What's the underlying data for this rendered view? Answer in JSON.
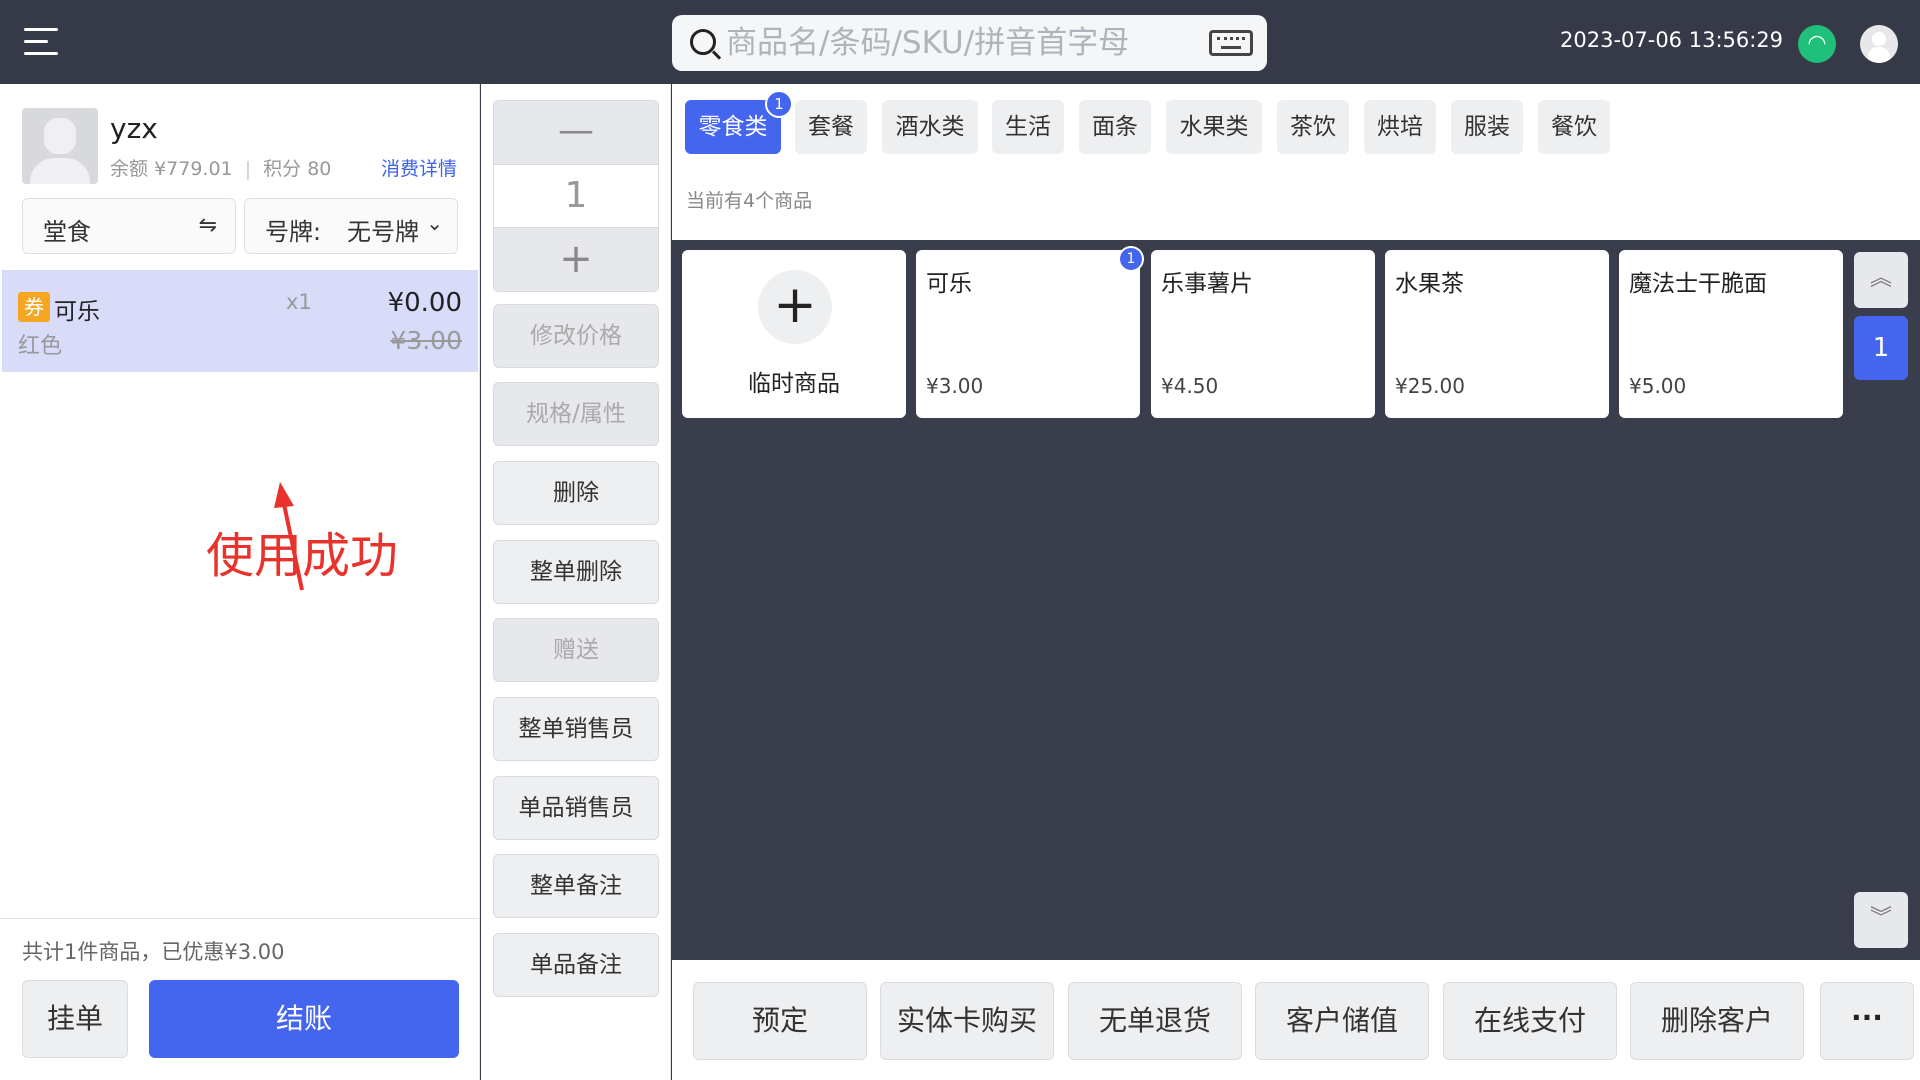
{
  "topbar": {
    "search_placeholder": "商品名/条码/SKU/拼音首字母",
    "datetime": "2023-07-06 13:56:29"
  },
  "customer": {
    "name": "yzx",
    "balance_label": "余额",
    "balance": "¥779.01",
    "points_label": "积分",
    "points": "80",
    "detail_link": "消费详情"
  },
  "order_type": {
    "label": "堂食",
    "icon": "⇋"
  },
  "plate": {
    "label": "号牌:",
    "value": "无号牌"
  },
  "cart": {
    "items": [
      {
        "badge": "券",
        "name": "可乐",
        "qty": "x1",
        "price": "¥0.00",
        "spec": "红色",
        "original_price": "¥3.00"
      }
    ],
    "summary": "共计1件商品，已优惠¥3.00",
    "hold_label": "挂单",
    "checkout_label": "结账"
  },
  "annotation": "使用成功",
  "quantity": {
    "minus": "—",
    "value": "1",
    "plus": "+"
  },
  "middle_buttons": [
    {
      "label": "修改价格",
      "disabled": true
    },
    {
      "label": "规格/属性",
      "disabled": true
    },
    {
      "label": "删除",
      "disabled": false
    },
    {
      "label": "整单删除",
      "disabled": false
    },
    {
      "label": "赠送",
      "disabled": true
    },
    {
      "label": "整单销售员",
      "disabled": false
    },
    {
      "label": "单品销售员",
      "disabled": false
    },
    {
      "label": "整单备注",
      "disabled": false
    },
    {
      "label": "单品备注",
      "disabled": false
    }
  ],
  "categories": [
    {
      "label": "零食类",
      "active": true,
      "badge": "1"
    },
    {
      "label": "套餐"
    },
    {
      "label": "酒水类"
    },
    {
      "label": "生活"
    },
    {
      "label": "面条"
    },
    {
      "label": "水果类"
    },
    {
      "label": "茶饮"
    },
    {
      "label": "烘培"
    },
    {
      "label": "服装"
    },
    {
      "label": "餐饮"
    }
  ],
  "goods_count": "当前有4个商品",
  "temp_goods": {
    "icon": "+",
    "label": "临时商品"
  },
  "goods": [
    {
      "name": "可乐",
      "price": "¥3.00",
      "badge": "1"
    },
    {
      "name": "乐事薯片",
      "price": "¥4.50"
    },
    {
      "name": "水果茶",
      "price": "¥25.00"
    },
    {
      "name": "魔法士干脆面",
      "price": "¥5.00"
    }
  ],
  "pager": {
    "up": "︽",
    "current": "1",
    "down": "︾"
  },
  "actions": [
    {
      "label": "预定"
    },
    {
      "label": "实体卡购买"
    },
    {
      "label": "无单退货"
    },
    {
      "label": "客户储值"
    },
    {
      "label": "在线支付"
    },
    {
      "label": "删除客户"
    }
  ],
  "more_label": "···",
  "colors": {
    "accent": "#4466ee",
    "topbar": "#363a48",
    "annotation": "#e8322b",
    "coupon": "#f6a623",
    "wifi": "#1ec07a"
  }
}
